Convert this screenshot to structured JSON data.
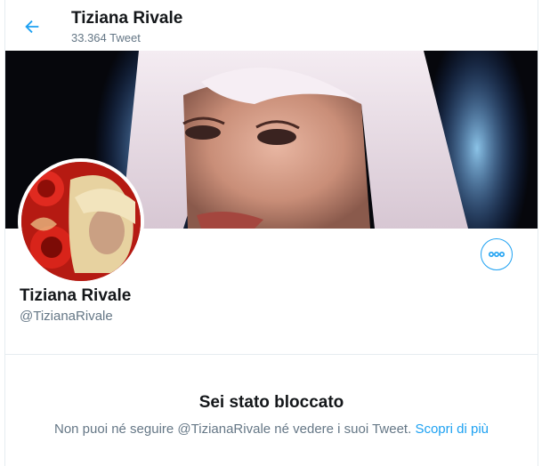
{
  "header": {
    "name": "Tiziana Rivale",
    "tweet_count": "33.364 Tweet"
  },
  "profile": {
    "name": "Tiziana Rivale",
    "handle": "@TizianaRivale"
  },
  "blocked": {
    "title": "Sei stato bloccato",
    "message": "Non puoi né seguire @TizianaRivale né vedere i suoi Tweet.",
    "link_label": "Scopri di più"
  },
  "icons": {
    "back": "arrow-left-icon",
    "more": "more-dots-icon"
  },
  "colors": {
    "accent": "#1da1f2",
    "muted": "#657786",
    "text": "#14171a"
  }
}
